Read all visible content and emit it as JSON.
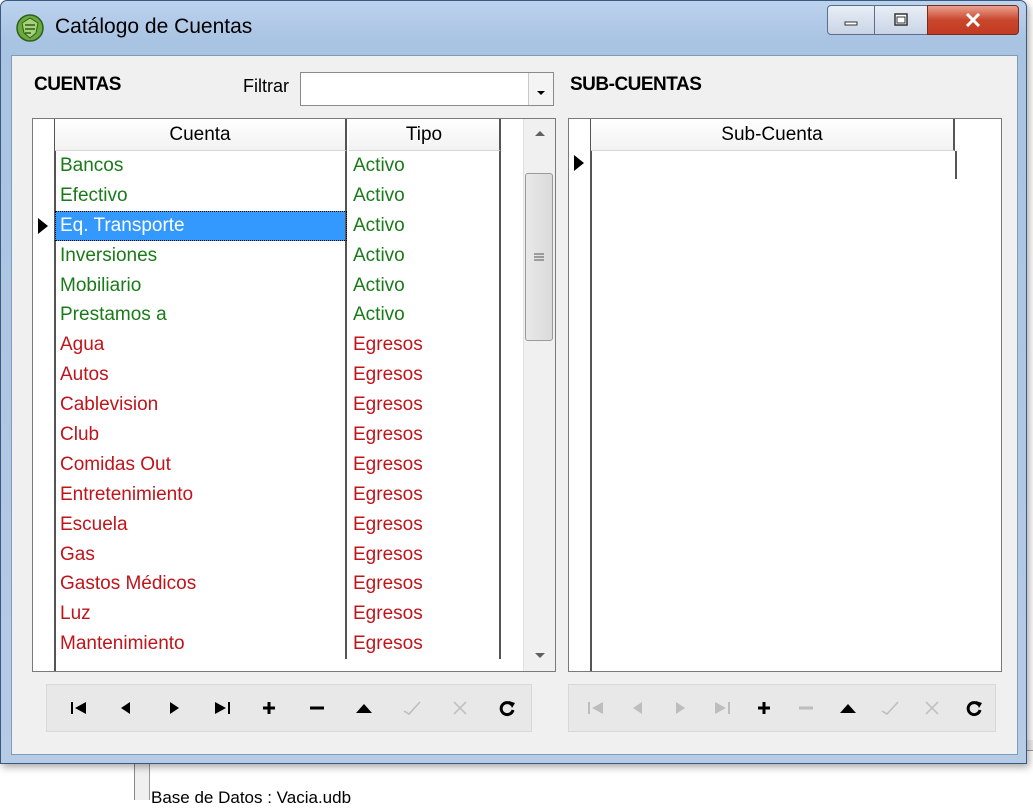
{
  "window": {
    "title": "Catálogo de Cuentas",
    "controls": {
      "minimize": "minimize",
      "maximize": "maximize",
      "close": "close"
    }
  },
  "background_app": {
    "status_text": "Base de Datos : Vacia.udb"
  },
  "cuentas": {
    "heading": "CUENTAS",
    "filter_label": "Filtrar",
    "filter_value": "",
    "columns": {
      "cuenta": "Cuenta",
      "tipo": "Tipo"
    },
    "selected_row": 2,
    "rows": [
      {
        "cuenta": "Bancos",
        "tipo": "Activo"
      },
      {
        "cuenta": "Efectivo",
        "tipo": "Activo"
      },
      {
        "cuenta": "Eq. Transporte",
        "tipo": "Activo"
      },
      {
        "cuenta": "Inversiones",
        "tipo": "Activo"
      },
      {
        "cuenta": "Mobiliario",
        "tipo": "Activo"
      },
      {
        "cuenta": "Prestamos a",
        "tipo": "Activo"
      },
      {
        "cuenta": "Agua",
        "tipo": "Egresos"
      },
      {
        "cuenta": "Autos",
        "tipo": "Egresos"
      },
      {
        "cuenta": "Cablevision",
        "tipo": "Egresos"
      },
      {
        "cuenta": "Club",
        "tipo": "Egresos"
      },
      {
        "cuenta": "Comidas Out",
        "tipo": "Egresos"
      },
      {
        "cuenta": "Entretenimiento",
        "tipo": "Egresos"
      },
      {
        "cuenta": "Escuela",
        "tipo": "Egresos"
      },
      {
        "cuenta": "Gas",
        "tipo": "Egresos"
      },
      {
        "cuenta": "Gastos Médicos",
        "tipo": "Egresos"
      },
      {
        "cuenta": "Luz",
        "tipo": "Egresos"
      },
      {
        "cuenta": "Mantenimiento",
        "tipo": "Egresos"
      }
    ],
    "type_colors": {
      "Activo": "#1a7a1a",
      "Egresos": "#c0141b"
    },
    "selection_color": "#3399ff"
  },
  "subcuentas": {
    "heading": "SUB-CUENTAS",
    "columns": {
      "sub_cuenta": "Sub-Cuenta"
    },
    "rows": []
  },
  "navigator_left": [
    {
      "name": "first",
      "icon": "first-record-icon",
      "enabled": true
    },
    {
      "name": "prior",
      "icon": "prior-record-icon",
      "enabled": true
    },
    {
      "name": "next",
      "icon": "next-record-icon",
      "enabled": true
    },
    {
      "name": "last",
      "icon": "last-record-icon",
      "enabled": true
    },
    {
      "name": "insert",
      "icon": "plus-icon",
      "enabled": true
    },
    {
      "name": "delete",
      "icon": "minus-icon",
      "enabled": true
    },
    {
      "name": "edit",
      "icon": "edit-up-icon",
      "enabled": true
    },
    {
      "name": "post",
      "icon": "check-icon",
      "enabled": false
    },
    {
      "name": "cancel",
      "icon": "x-icon",
      "enabled": false
    },
    {
      "name": "refresh",
      "icon": "refresh-icon",
      "enabled": true
    }
  ],
  "navigator_right": [
    {
      "name": "first",
      "icon": "first-record-icon",
      "enabled": false
    },
    {
      "name": "prior",
      "icon": "prior-record-icon",
      "enabled": false
    },
    {
      "name": "next",
      "icon": "next-record-icon",
      "enabled": false
    },
    {
      "name": "last",
      "icon": "last-record-icon",
      "enabled": false
    },
    {
      "name": "insert",
      "icon": "plus-icon",
      "enabled": true
    },
    {
      "name": "delete",
      "icon": "minus-icon",
      "enabled": false
    },
    {
      "name": "edit",
      "icon": "edit-up-icon",
      "enabled": true
    },
    {
      "name": "post",
      "icon": "check-icon",
      "enabled": false
    },
    {
      "name": "cancel",
      "icon": "x-icon",
      "enabled": false
    },
    {
      "name": "refresh",
      "icon": "refresh-icon",
      "enabled": true
    }
  ]
}
